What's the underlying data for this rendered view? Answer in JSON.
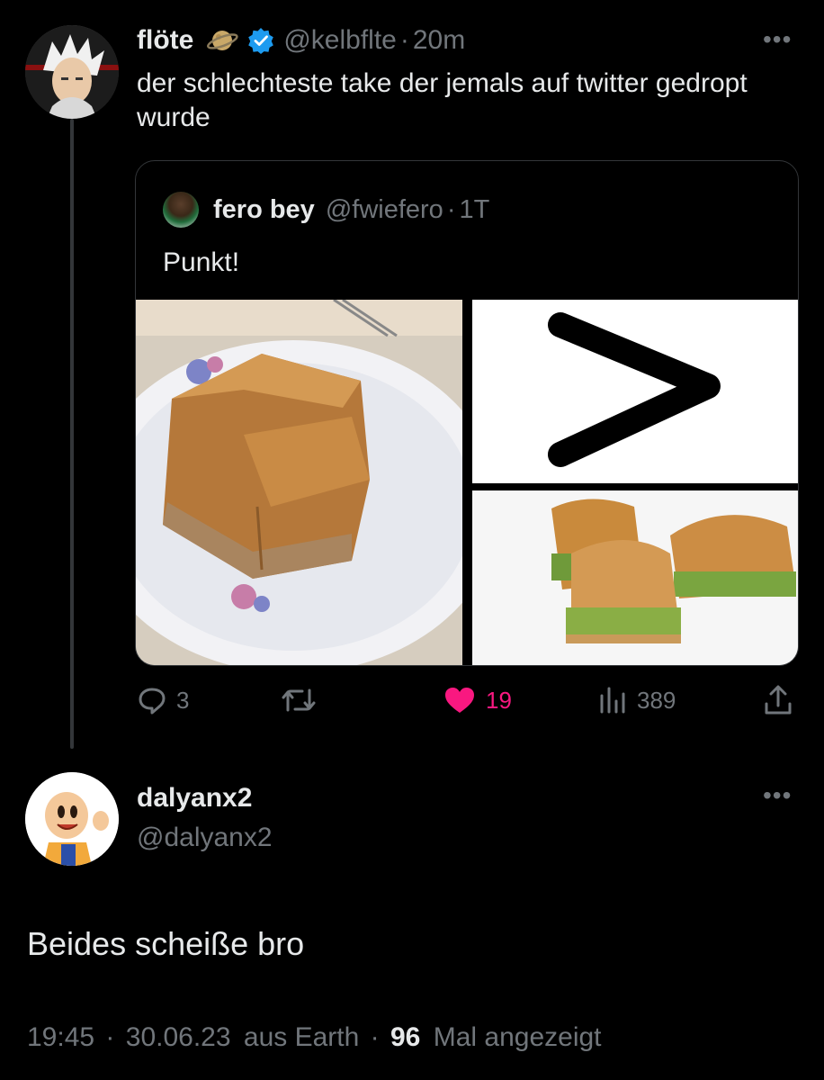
{
  "tweet1": {
    "name": "flöte",
    "handle": "@kelbflte",
    "separator": "·",
    "time": "20m",
    "text": "der schlechteste take der jemals auf twitter gedropt wurde",
    "more_icon": "more-horizontal-icon",
    "badges": [
      "planet-icon",
      "verified-icon"
    ]
  },
  "quote": {
    "name": "fero bey",
    "handle": "@fwiefero",
    "separator": "·",
    "time": "1T",
    "text": "Punkt!"
  },
  "actions": {
    "reply_count": "3",
    "retweet_count": "",
    "like_count": "19",
    "views_count": "389"
  },
  "tweet2": {
    "name": "dalyanx2",
    "handle": "@dalyanx2",
    "text": "Beides scheiße bro",
    "more_icon": "more-horizontal-icon"
  },
  "meta": {
    "time": "19:45",
    "sep1": "·",
    "date": "30.06.23",
    "location": "aus Earth",
    "sep2": "·",
    "views": "96",
    "views_label": "Mal angezeigt"
  },
  "colors": {
    "background": "#000000",
    "text_primary": "#e7e9ea",
    "text_secondary": "#71767b",
    "like_pink": "#f91880",
    "verified_blue": "#1d9bf0",
    "border": "#333639"
  }
}
